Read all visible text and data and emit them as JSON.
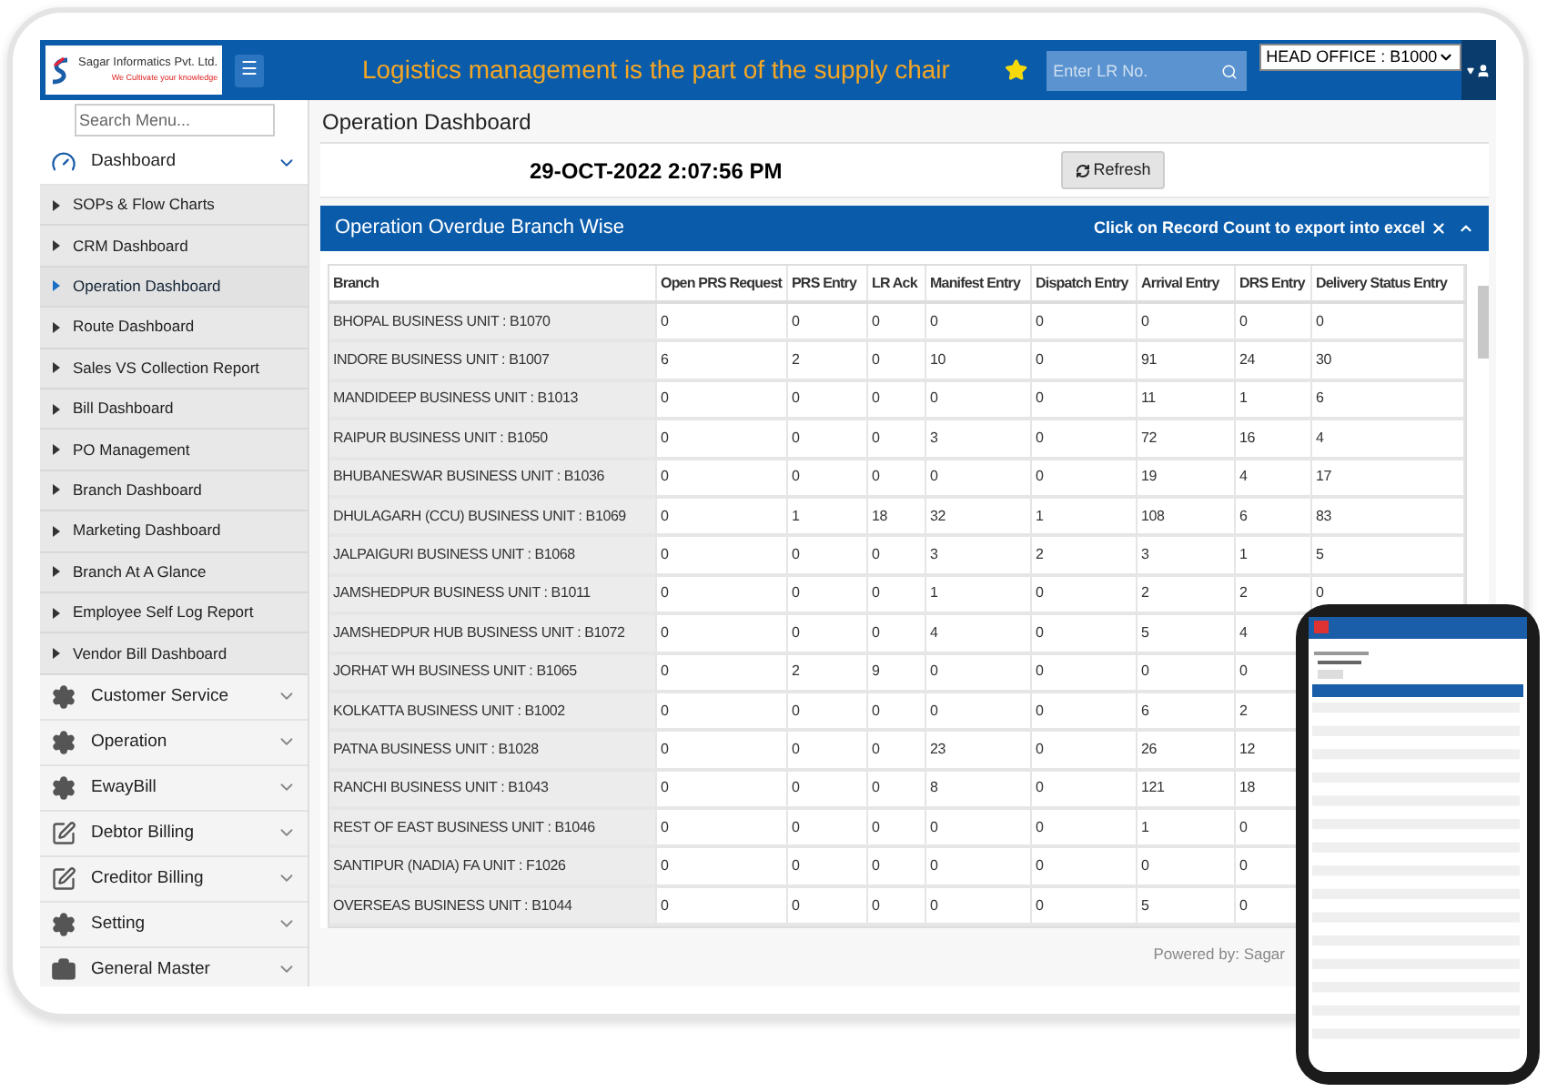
{
  "header": {
    "company": "Sagar Informatics Pvt. Ltd.",
    "tagline": "We Cultivate your knowledge",
    "menu_button": "☰",
    "slogan": "Logistics management is the part of the supply chair",
    "lr_search": {
      "placeholder": "Enter LR No."
    },
    "branch_select": "HEAD OFFICE : B1000"
  },
  "sidebar": {
    "search": {
      "placeholder": "Search Menu..."
    },
    "items": [
      {
        "label": "Dashboard",
        "expanded": true,
        "children": [
          {
            "label": "SOPs & Flow Charts",
            "selected": false
          },
          {
            "label": "CRM Dashboard",
            "selected": false
          },
          {
            "label": "Operation Dashboard",
            "selected": true
          },
          {
            "label": "Route Dashboard",
            "selected": false
          },
          {
            "label": "Sales VS Collection Report",
            "selected": false
          },
          {
            "label": "Bill Dashboard",
            "selected": false
          },
          {
            "label": "PO Management",
            "selected": false
          },
          {
            "label": "Branch Dashboard",
            "selected": false
          },
          {
            "label": "Marketing Dashboard",
            "selected": false
          },
          {
            "label": "Branch At A Glance",
            "selected": false
          },
          {
            "label": "Employee Self Log Report",
            "selected": false
          },
          {
            "label": "Vendor Bill Dashboard",
            "selected": false
          }
        ]
      },
      {
        "label": "Customer Service",
        "expanded": false
      },
      {
        "label": "Operation",
        "expanded": false
      },
      {
        "label": "EwayBill",
        "expanded": false
      },
      {
        "label": "Debtor Billing",
        "expanded": false
      },
      {
        "label": "Creditor Billing",
        "expanded": false
      },
      {
        "label": "Setting",
        "expanded": false
      },
      {
        "label": "General Master",
        "expanded": false
      }
    ]
  },
  "page_title": "Operation Dashboard",
  "datetime": "29-OCT-2022 2:07:56 PM",
  "refresh_button": "Refresh",
  "panel": {
    "title": "Operation Overdue Branch Wise",
    "hint": "Click on Record Count to export into excel",
    "table": {
      "columns": [
        "Branch",
        "Open PRS Request",
        "PRS Entry",
        "LR Ack",
        "Manifest Entry",
        "Dispatch Entry",
        "Arrival Entry",
        "DRS Entry",
        "Delivery Status Entry"
      ],
      "rows": [
        [
          "BHOPAL BUSINESS UNIT : B1070",
          "0",
          "0",
          "0",
          "0",
          "0",
          "0",
          "0",
          "0"
        ],
        [
          "INDORE BUSINESS UNIT : B1007",
          "6",
          "2",
          "0",
          "10",
          "0",
          "91",
          "24",
          "30"
        ],
        [
          "MANDIDEEP BUSINESS UNIT : B1013",
          "0",
          "0",
          "0",
          "0",
          "0",
          "11",
          "1",
          "6"
        ],
        [
          "RAIPUR BUSINESS UNIT : B1050",
          "0",
          "0",
          "0",
          "3",
          "0",
          "72",
          "16",
          "4"
        ],
        [
          "BHUBANESWAR BUSINESS UNIT : B1036",
          "0",
          "0",
          "0",
          "0",
          "0",
          "19",
          "4",
          "17"
        ],
        [
          "DHULAGARH (CCU) BUSINESS UNIT : B1069",
          "0",
          "1",
          "18",
          "32",
          "1",
          "108",
          "6",
          "83"
        ],
        [
          "JALPAIGURI BUSINESS UNIT : B1068",
          "0",
          "0",
          "0",
          "3",
          "2",
          "3",
          "1",
          "5"
        ],
        [
          "JAMSHEDPUR BUSINESS UNIT : B1011",
          "0",
          "0",
          "0",
          "1",
          "0",
          "2",
          "2",
          "0"
        ],
        [
          "JAMSHEDPUR HUB BUSINESS UNIT : B1072",
          "0",
          "0",
          "0",
          "4",
          "0",
          "5",
          "4",
          null
        ],
        [
          "JORHAT WH BUSINESS UNIT : B1065",
          "0",
          "2",
          "9",
          "0",
          "0",
          "0",
          "0",
          null
        ],
        [
          "KOLKATTA BUSINESS UNIT : B1002",
          "0",
          "0",
          "0",
          "0",
          "0",
          "6",
          "2",
          null
        ],
        [
          "PATNA BUSINESS UNIT : B1028",
          "0",
          "0",
          "0",
          "23",
          "0",
          "26",
          "12",
          null
        ],
        [
          "RANCHI BUSINESS UNIT : B1043",
          "0",
          "0",
          "0",
          "8",
          "0",
          "121",
          "18",
          null
        ],
        [
          "REST OF EAST BUSINESS UNIT : B1046",
          "0",
          "0",
          "0",
          "0",
          "0",
          "1",
          "0",
          null
        ],
        [
          "SANTIPUR (NADIA) FA UNIT : F1026",
          "0",
          "0",
          "0",
          "0",
          "0",
          "0",
          "0",
          null
        ],
        [
          "OVERSEAS BUSINESS UNIT : B1044",
          "0",
          "0",
          "0",
          "0",
          "0",
          "5",
          "0",
          null
        ]
      ]
    }
  },
  "footer": "Powered by: Sagar"
}
